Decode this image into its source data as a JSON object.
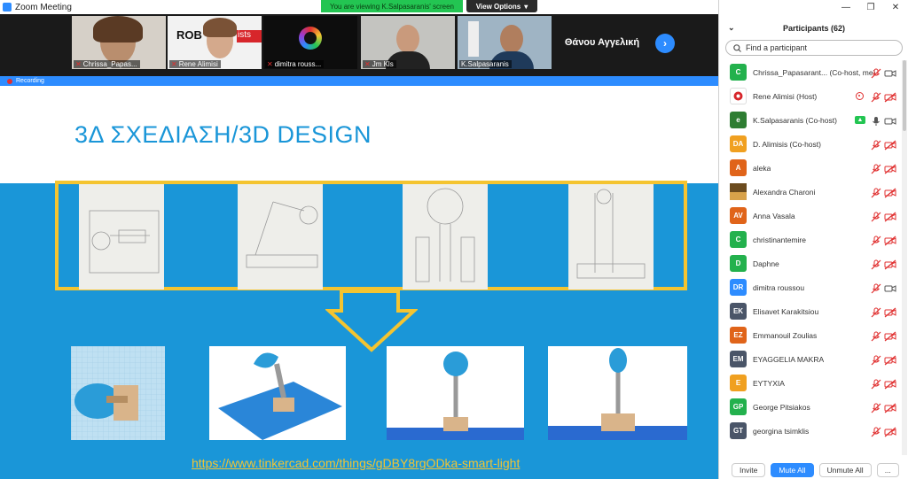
{
  "window": {
    "title": "Zoom Meeting",
    "viewing_banner": "You are viewing K.Salpasaranis' screen",
    "view_options_label": "View Options"
  },
  "gallery": {
    "tiles": [
      {
        "name": "Chrissa_Papas..."
      },
      {
        "name": "Rene Alimisi",
        "logo_text": "ROB",
        "logo_text2": "ists"
      },
      {
        "name": "dimitra rouss..."
      },
      {
        "name": "Jm Kls"
      },
      {
        "name": "K.Salpasaranis"
      }
    ],
    "name_only_tile": "Θάνου Αγγελική",
    "next_icon": "chevron-right-icon"
  },
  "recording_label": "Recording",
  "slide": {
    "title": "3Δ ΣΧΕΔΙΑΣΗ/3D DESIGN",
    "link_text": "https://www.tinkercad.com/things/gDBY8rgODka-smart-light",
    "accent_color": "#f4c430",
    "background_color": "#1a96d8"
  },
  "panel": {
    "title": "Participants (62)",
    "search_placeholder": "Find a participant",
    "participants": [
      {
        "initials": "C",
        "name": "Chrissa_Papasarant... (Co-host, me)",
        "color": "#23b14d",
        "mic": "muted",
        "cam": "on",
        "extra": ""
      },
      {
        "initials": "",
        "name": "Rene Alimisi (Host)",
        "color": "#ffffff",
        "mic": "muted",
        "cam": "off",
        "extra": "recording"
      },
      {
        "initials": "e",
        "name": "K.Salpasaranis (Co-host)",
        "color": "#2e7d32",
        "mic": "on",
        "cam": "on",
        "extra": "sharing"
      },
      {
        "initials": "DA",
        "name": "D. Alimisis (Co-host)",
        "color": "#f0a020",
        "mic": "muted",
        "cam": "off",
        "extra": ""
      },
      {
        "initials": "A",
        "name": "aleka",
        "color": "#e0641a",
        "mic": "muted",
        "cam": "off",
        "extra": ""
      },
      {
        "initials": "",
        "name": "Alexandra Charoni",
        "color": "#6b4b1e",
        "mic": "muted",
        "cam": "off",
        "extra": ""
      },
      {
        "initials": "AV",
        "name": "Anna Vasala",
        "color": "#e0641a",
        "mic": "muted",
        "cam": "off",
        "extra": ""
      },
      {
        "initials": "C",
        "name": "christinantemire",
        "color": "#23b14d",
        "mic": "muted",
        "cam": "off",
        "extra": ""
      },
      {
        "initials": "D",
        "name": "Daphne",
        "color": "#23b14d",
        "mic": "muted",
        "cam": "off",
        "extra": ""
      },
      {
        "initials": "DR",
        "name": "dimitra roussou",
        "color": "#2d8cff",
        "mic": "muted",
        "cam": "on",
        "extra": ""
      },
      {
        "initials": "EK",
        "name": "Elisavet Karakitsiou",
        "color": "#4a5568",
        "mic": "muted",
        "cam": "off",
        "extra": ""
      },
      {
        "initials": "EZ",
        "name": "Emmanouil Zoulias",
        "color": "#e0641a",
        "mic": "muted",
        "cam": "off",
        "extra": ""
      },
      {
        "initials": "EM",
        "name": "EYAGGELIA MAKRA",
        "color": "#4a5568",
        "mic": "muted",
        "cam": "off",
        "extra": ""
      },
      {
        "initials": "E",
        "name": "EYTYXIA",
        "color": "#f0a020",
        "mic": "muted",
        "cam": "off",
        "extra": ""
      },
      {
        "initials": "GP",
        "name": "George Pitsiakos",
        "color": "#23b14d",
        "mic": "muted",
        "cam": "off",
        "extra": ""
      },
      {
        "initials": "GT",
        "name": "georgina tsimklis",
        "color": "#4a5568",
        "mic": "muted",
        "cam": "off",
        "extra": ""
      }
    ],
    "footer": {
      "invite": "Invite",
      "mute_all": "Mute All",
      "unmute_all": "Unmute All",
      "more": "..."
    }
  }
}
